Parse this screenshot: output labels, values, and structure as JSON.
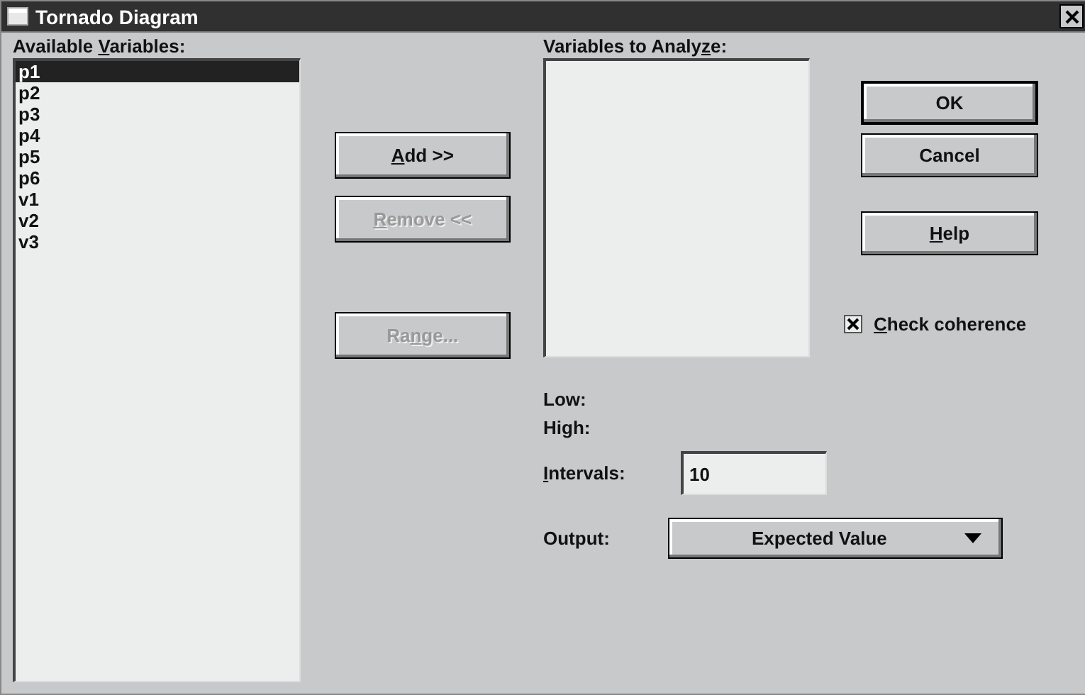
{
  "window": {
    "title": "Tornado Diagram"
  },
  "available_variables": {
    "label_parts": [
      {
        "text": "Available ",
        "underline": false
      },
      {
        "text": "V",
        "underline": true
      },
      {
        "text": "ariables:",
        "underline": false
      }
    ],
    "items": [
      {
        "label": "p1",
        "selected": true
      },
      {
        "label": "p2",
        "selected": false
      },
      {
        "label": "p3",
        "selected": false
      },
      {
        "label": "p4",
        "selected": false
      },
      {
        "label": "p5",
        "selected": false
      },
      {
        "label": "p6",
        "selected": false
      },
      {
        "label": "v1",
        "selected": false
      },
      {
        "label": "v2",
        "selected": false
      },
      {
        "label": "v3",
        "selected": false
      }
    ]
  },
  "move_buttons": [
    {
      "label_parts": [
        {
          "text": "A",
          "underline": true
        },
        {
          "text": "dd >>",
          "underline": false
        }
      ],
      "disabled": false
    },
    {
      "label_parts": [
        {
          "text": "R",
          "underline": true
        },
        {
          "text": "emove <<",
          "underline": false
        }
      ],
      "disabled": true
    },
    {
      "label_parts": [
        {
          "text": "Ra",
          "underline": false
        },
        {
          "text": "n",
          "underline": true
        },
        {
          "text": "ge...",
          "underline": false
        }
      ],
      "disabled": true
    }
  ],
  "variables_to_analyze": {
    "label_parts": [
      {
        "text": "Variables to Analy",
        "underline": false
      },
      {
        "text": "z",
        "underline": true
      },
      {
        "text": "e:",
        "underline": false
      }
    ]
  },
  "dialog_buttons": [
    {
      "label_parts": [
        {
          "text": "OK",
          "underline": false
        }
      ],
      "default": true
    },
    {
      "label_parts": [
        {
          "text": "Cancel",
          "underline": false
        }
      ],
      "default": false
    },
    {
      "label_parts": [
        {
          "text": "H",
          "underline": true
        },
        {
          "text": "elp",
          "underline": false
        }
      ],
      "default": false
    }
  ],
  "check_coherence": {
    "label_parts": [
      {
        "text": "C",
        "underline": true
      },
      {
        "text": "heck coherence",
        "underline": false
      }
    ],
    "checked": true
  },
  "low": {
    "label": "Low:"
  },
  "high": {
    "label": "High:"
  },
  "intervals": {
    "label_parts": [
      {
        "text": "I",
        "underline": true
      },
      {
        "text": "ntervals:",
        "underline": false
      }
    ],
    "value": "10"
  },
  "output": {
    "label": "Output:",
    "value": "Expected Value"
  }
}
